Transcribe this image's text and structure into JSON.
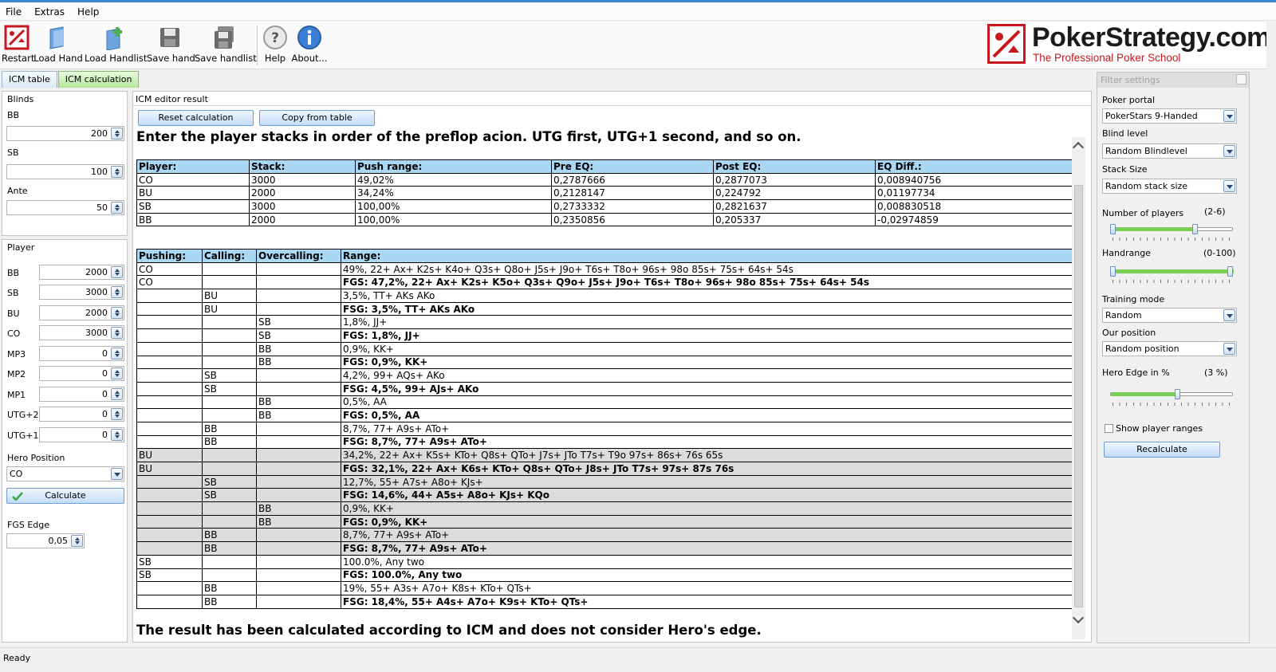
{
  "menu": [
    "File",
    "Extras",
    "Help"
  ],
  "toolbar": {
    "buttons": [
      {
        "label": "Restart",
        "icon": "restart-icon"
      },
      {
        "label": "Load Hand",
        "icon": "load-hand-icon"
      },
      {
        "label": "Load Handlist",
        "icon": "load-handlist-icon"
      },
      {
        "label": "Save hand",
        "icon": "save-hand-icon"
      },
      {
        "label": "Save handlist",
        "icon": "save-handlist-icon"
      },
      {
        "label": "Help",
        "icon": "help-icon"
      },
      {
        "label": "About...",
        "icon": "info-icon"
      }
    ]
  },
  "logo": {
    "title": "PokerStrategy.com",
    "subtitle": "The Professional Poker School"
  },
  "tabs": [
    "ICM table",
    "ICM calculation"
  ],
  "blinds": {
    "title": "Blinds",
    "bb_label": "BB",
    "bb_value": "200",
    "sb_label": "SB",
    "sb_value": "100",
    "ante_label": "Ante",
    "ante_value": "50"
  },
  "player": {
    "title": "Player",
    "rows": [
      {
        "label": "BB",
        "value": "2000"
      },
      {
        "label": "SB",
        "value": "3000"
      },
      {
        "label": "BU",
        "value": "2000"
      },
      {
        "label": "CO",
        "value": "3000"
      },
      {
        "label": "MP3",
        "value": "0"
      },
      {
        "label": "MP2",
        "value": "0"
      },
      {
        "label": "MP1",
        "value": "0"
      },
      {
        "label": "UTG+2",
        "value": "0"
      },
      {
        "label": "UTG+1",
        "value": "0"
      }
    ],
    "hero_position_label": "Hero Position",
    "hero_position_value": "CO",
    "calculate_label": "Calculate",
    "fgs_edge_label": "FGS Edge",
    "fgs_edge_value": "0,05"
  },
  "editor": {
    "title": "ICM editor result",
    "reset_label": "Reset calculation",
    "copy_label": "Copy from table",
    "instruction": "Enter the player stacks in order of the preflop acion. UTG first, UTG+1 second, and so on.",
    "footer": "The result has been calculated according to ICM and does not consider Hero's edge."
  },
  "eq_table": {
    "headers": [
      "Player:",
      "Stack:",
      "Push range:",
      "Pre EQ:",
      "Post EQ:",
      "EQ Diff.:"
    ],
    "rows": [
      [
        "CO",
        "3000",
        "49,02%",
        "0,2787666",
        "0,2877073",
        "0,008940756"
      ],
      [
        "BU",
        "2000",
        "34,24%",
        "0,2128147",
        "0,224792",
        "0,01197734"
      ],
      [
        "SB",
        "3000",
        "100,00%",
        "0,2733332",
        "0,2821637",
        "0,008830518"
      ],
      [
        "BB",
        "2000",
        "100,00%",
        "0,2350856",
        "0,205337",
        "-0,02974859"
      ]
    ]
  },
  "range_table": {
    "headers": [
      "Pushing:",
      "Calling:",
      "Overcalling:",
      "Range:"
    ],
    "rows": [
      {
        "cells": [
          "CO",
          "",
          "",
          "49%, 22+ Ax+ K2s+ K4o+ Q3s+ Q8o+ J5s+ J9o+ T6s+ T8o+ 96s+ 98o 85s+ 75s+ 64s+ 54s"
        ],
        "bold": false,
        "gray": false
      },
      {
        "cells": [
          "CO",
          "",
          "",
          "FGS: 47,2%, 22+ Ax+ K2s+ K5o+ Q3s+ Q9o+ J5s+ J9o+ T6s+ T8o+ 96s+ 98o 85s+ 75s+ 64s+ 54s"
        ],
        "bold": true,
        "gray": false
      },
      {
        "cells": [
          "",
          "BU",
          "",
          "3,5%, TT+ AKs AKo"
        ],
        "bold": false,
        "gray": false
      },
      {
        "cells": [
          "",
          "BU",
          "",
          "FSG: 3,5%, TT+ AKs AKo"
        ],
        "bold": true,
        "gray": false
      },
      {
        "cells": [
          "",
          "",
          "SB",
          "1,8%, JJ+"
        ],
        "bold": false,
        "gray": false
      },
      {
        "cells": [
          "",
          "",
          "SB",
          "FGS: 1,8%, JJ+"
        ],
        "bold": true,
        "gray": false
      },
      {
        "cells": [
          "",
          "",
          "BB",
          "0,9%, KK+"
        ],
        "bold": false,
        "gray": false
      },
      {
        "cells": [
          "",
          "",
          "BB",
          "FGS: 0,9%, KK+"
        ],
        "bold": true,
        "gray": false
      },
      {
        "cells": [
          "",
          "SB",
          "",
          "4,2%, 99+ AQs+ AKo"
        ],
        "bold": false,
        "gray": false
      },
      {
        "cells": [
          "",
          "SB",
          "",
          "FSG: 4,5%, 99+ AJs+ AKo"
        ],
        "bold": true,
        "gray": false
      },
      {
        "cells": [
          "",
          "",
          "BB",
          "0,5%, AA"
        ],
        "bold": false,
        "gray": false
      },
      {
        "cells": [
          "",
          "",
          "BB",
          "FGS: 0,5%, AA"
        ],
        "bold": true,
        "gray": false
      },
      {
        "cells": [
          "",
          "BB",
          "",
          "8,7%, 77+ A9s+ ATo+"
        ],
        "bold": false,
        "gray": false
      },
      {
        "cells": [
          "",
          "BB",
          "",
          "FSG: 8,7%, 77+ A9s+ ATo+"
        ],
        "bold": true,
        "gray": false
      },
      {
        "cells": [
          "BU",
          "",
          "",
          "34,2%, 22+ Ax+ K5s+ KTo+ Q8s+ QTo+ J7s+ JTo T7s+ T9o 97s+ 86s+ 76s 65s"
        ],
        "bold": false,
        "gray": true
      },
      {
        "cells": [
          "BU",
          "",
          "",
          "FGS: 32,1%, 22+ Ax+ K6s+ KTo+ Q8s+ QTo+ J8s+ JTo T7s+ 97s+ 87s 76s"
        ],
        "bold": true,
        "gray": true
      },
      {
        "cells": [
          "",
          "SB",
          "",
          "12,7%, 55+ A7s+ A8o+ KJs+"
        ],
        "bold": false,
        "gray": true
      },
      {
        "cells": [
          "",
          "SB",
          "",
          "FSG: 14,6%, 44+ A5s+ A8o+ KJs+ KQo"
        ],
        "bold": true,
        "gray": true
      },
      {
        "cells": [
          "",
          "",
          "BB",
          "0,9%, KK+"
        ],
        "bold": false,
        "gray": true
      },
      {
        "cells": [
          "",
          "",
          "BB",
          "FGS: 0,9%, KK+"
        ],
        "bold": true,
        "gray": true
      },
      {
        "cells": [
          "",
          "BB",
          "",
          "8,7%, 77+ A9s+ ATo+"
        ],
        "bold": false,
        "gray": true
      },
      {
        "cells": [
          "",
          "BB",
          "",
          "FSG: 8,7%, 77+ A9s+ ATo+"
        ],
        "bold": true,
        "gray": true
      },
      {
        "cells": [
          "SB",
          "",
          "",
          "100.0%, Any two"
        ],
        "bold": false,
        "gray": false
      },
      {
        "cells": [
          "SB",
          "",
          "",
          "FGS: 100.0%, Any two"
        ],
        "bold": true,
        "gray": false
      },
      {
        "cells": [
          "",
          "BB",
          "",
          "19%, 55+ A3s+ A7o+ K8s+ KTo+ QTs+"
        ],
        "bold": false,
        "gray": false
      },
      {
        "cells": [
          "",
          "BB",
          "",
          "FSG: 18,4%, 55+ A4s+ A7o+ K9s+ KTo+ QTs+"
        ],
        "bold": true,
        "gray": false
      }
    ]
  },
  "filter": {
    "title": "Filter settings",
    "poker_portal_label": "Poker portal",
    "poker_portal_value": "PokerStars 9-Handed",
    "blind_level_label": "Blind level",
    "blind_level_value": "Random Blindlevel",
    "stack_size_label": "Stack Size",
    "stack_size_value": "Random stack size",
    "num_players_label": "Number of players",
    "num_players_range": "(2-6)",
    "num_players_slider": [
      0,
      0.7
    ],
    "handrange_label": "Handrange",
    "handrange_range": "(0-100)",
    "handrange_slider": [
      0,
      1.0
    ],
    "training_mode_label": "Training mode",
    "training_mode_value": "Random",
    "our_position_label": "Our position",
    "our_position_value": "Random position",
    "hero_edge_label": "Hero Edge in %",
    "hero_edge_value": "(3 %)",
    "hero_edge_slider": 0.55,
    "show_ranges_label": "Show player ranges",
    "recalculate_label": "Recalculate"
  },
  "status": "Ready",
  "colors": {
    "accent_red": "#c8171e",
    "header_blue": "#aad7f3",
    "slider_green": "#7ccf55",
    "tab_active_green": "#b5e59c"
  }
}
